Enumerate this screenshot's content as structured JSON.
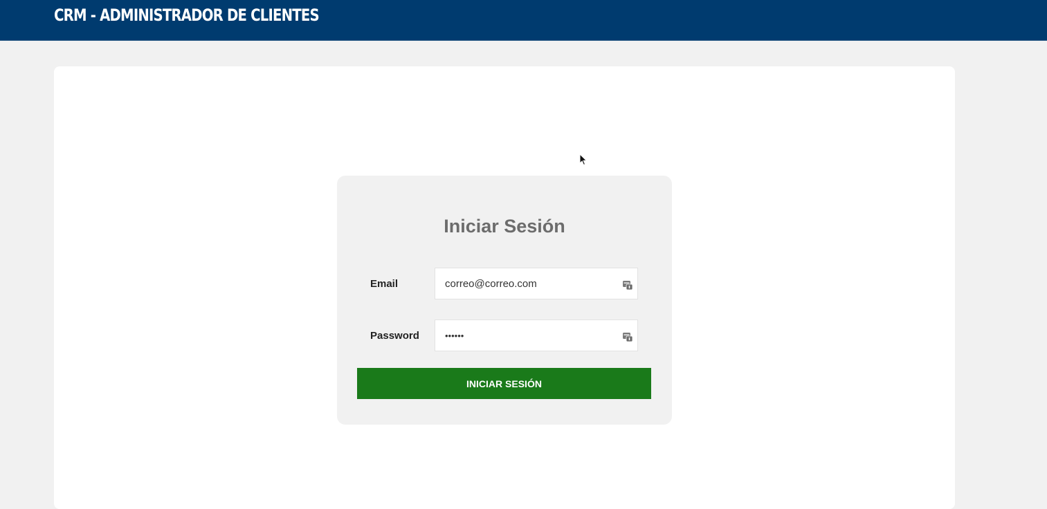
{
  "app": {
    "title": "CRM - ADMINISTRADOR DE CLIENTES",
    "header_color": "#003b6f"
  },
  "login": {
    "heading": "Iniciar Sesión",
    "email": {
      "label": "Email",
      "value": "correo@correo.com",
      "icon": "autofill-key-icon"
    },
    "password": {
      "label": "Password",
      "value": "••••••",
      "icon": "autofill-key-icon"
    },
    "submit_label": "INICIAR SESIÓN",
    "submit_color": "#1a7a1a"
  }
}
